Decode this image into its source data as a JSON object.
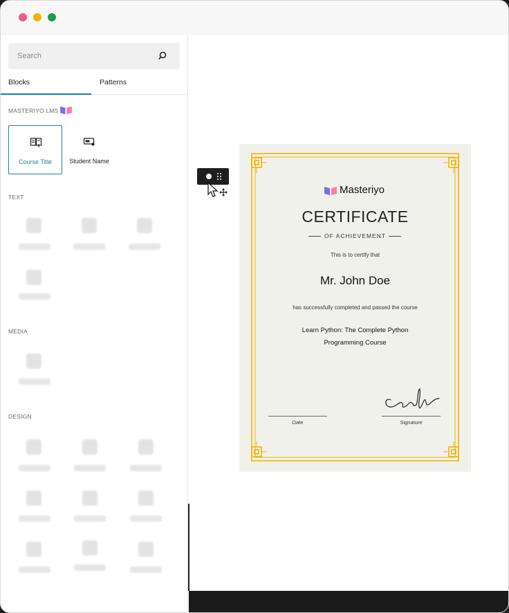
{
  "window": {
    "controls": [
      "close",
      "minimize",
      "maximize"
    ]
  },
  "sidebar": {
    "search": {
      "placeholder": "Search",
      "icon": "search-icon"
    },
    "tabs": [
      {
        "label": "Blocks",
        "active": true
      },
      {
        "label": "Patterns",
        "active": false
      }
    ],
    "sections": {
      "lms": {
        "label": "MASTERIYO LMS",
        "blocks": [
          {
            "label": "Course Title",
            "icon": "course-title-icon",
            "selected": true
          },
          {
            "label": "Student Name",
            "icon": "student-name-icon",
            "selected": false
          }
        ]
      },
      "text": {
        "label": "TEXT"
      },
      "media": {
        "label": "MEDIA"
      },
      "design": {
        "label": "DESIGN"
      }
    }
  },
  "certificate": {
    "brand": "Masteriyo",
    "title": "CERTIFICATE",
    "subtitle": "OF ACHIEVEMENT",
    "certify_text": "This is to certify that",
    "recipient": "Mr. John Doe",
    "completion_text": "has successfully completed and passed the course",
    "course_line1": "Learn Python: The Complete Python",
    "course_line2": "Programming Course",
    "date_label": "Date",
    "signature_label": "Signature",
    "border_color": "#f0b400",
    "background_color": "#f1f1ec"
  },
  "colors": {
    "accent": "#1f7ea1",
    "brand_purple": "#6c5ce7",
    "brand_pink": "#ff6b9a"
  }
}
